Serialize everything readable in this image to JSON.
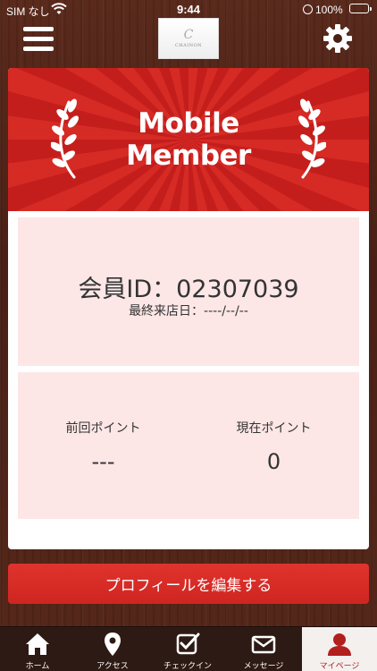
{
  "status_bar": {
    "carrier": "SIM なし",
    "time": "9:44",
    "battery": "100%"
  },
  "header": {
    "logo_mark": "C",
    "logo_text": "CHAINON",
    "menu_icon": "hamburger-icon",
    "settings_icon": "gear-icon"
  },
  "banner": {
    "title_line1": "Mobile",
    "title_line2": "Member"
  },
  "member": {
    "id_label": "会員ID：02307039",
    "last_visit": "最終来店日：----/--/--"
  },
  "points": {
    "previous_label": "前回ポイント",
    "previous_value": "---",
    "current_label": "現在ポイント",
    "current_value": "0"
  },
  "profile_button": "プロフィールを編集する",
  "tabs": [
    {
      "label": "ホーム",
      "icon": "home-icon"
    },
    {
      "label": "アクセス",
      "icon": "map-pin-icon"
    },
    {
      "label": "チェックイン",
      "icon": "checkbox-icon"
    },
    {
      "label": "メッセージ",
      "icon": "envelope-icon"
    },
    {
      "label": "マイページ",
      "icon": "user-icon",
      "active": true
    }
  ],
  "colors": {
    "brand_red": "#d62a25",
    "panel_pink": "#fde6e6",
    "tab_bar": "#2e1a14",
    "active_tab_text": "#b21f1d"
  }
}
